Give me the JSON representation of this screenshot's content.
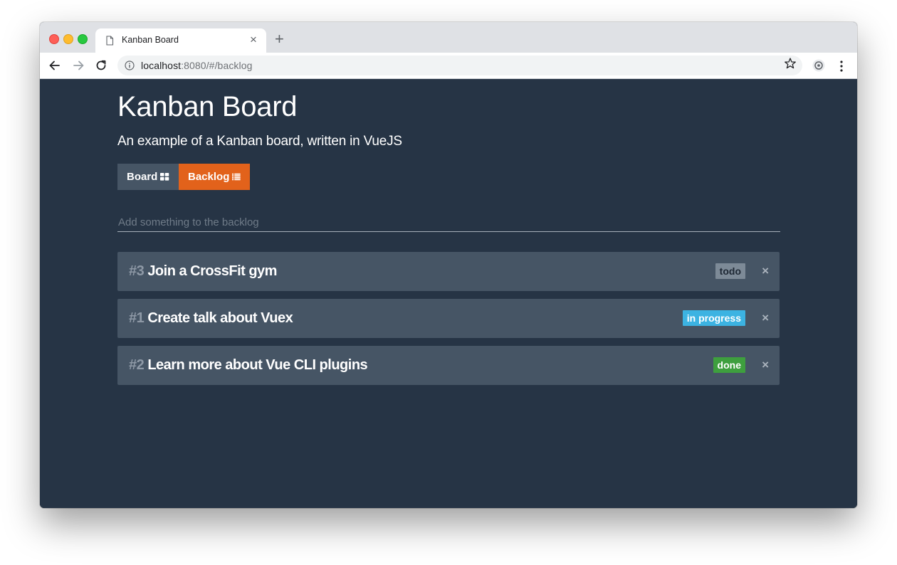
{
  "browser": {
    "tab_title": "Kanban Board",
    "tab_close": "×",
    "new_tab": "+",
    "url_host": "localhost",
    "url_rest": ":8080/#/backlog"
  },
  "app": {
    "title": "Kanban Board",
    "subtitle": "An example of a Kanban board, written in VueJS",
    "nav": {
      "board_label": "Board",
      "backlog_label": "Backlog",
      "active": "Backlog"
    },
    "add_input_placeholder": "Add something to the backlog",
    "items": [
      {
        "id": "#3",
        "text": "Join a CrossFit gym",
        "status": "todo",
        "remove": "×"
      },
      {
        "id": "#1",
        "text": "Create talk about Vuex",
        "status": "in progress",
        "remove": "×"
      },
      {
        "id": "#2",
        "text": "Learn more about Vue CLI plugins",
        "status": "done",
        "remove": "×"
      }
    ]
  },
  "colors": {
    "page_bg": "#263445",
    "item_bg": "#465565",
    "accent": "#e2621b",
    "todo": "#7d8a97",
    "in_progress": "#3cb3e2",
    "done": "#3e9f3e"
  },
  "icons": [
    "back-arrow-icon",
    "forward-arrow-icon",
    "reload-icon",
    "info-icon",
    "star-icon",
    "extension-icon",
    "more-menu-icon",
    "document-icon",
    "grid-icon",
    "list-icon"
  ]
}
